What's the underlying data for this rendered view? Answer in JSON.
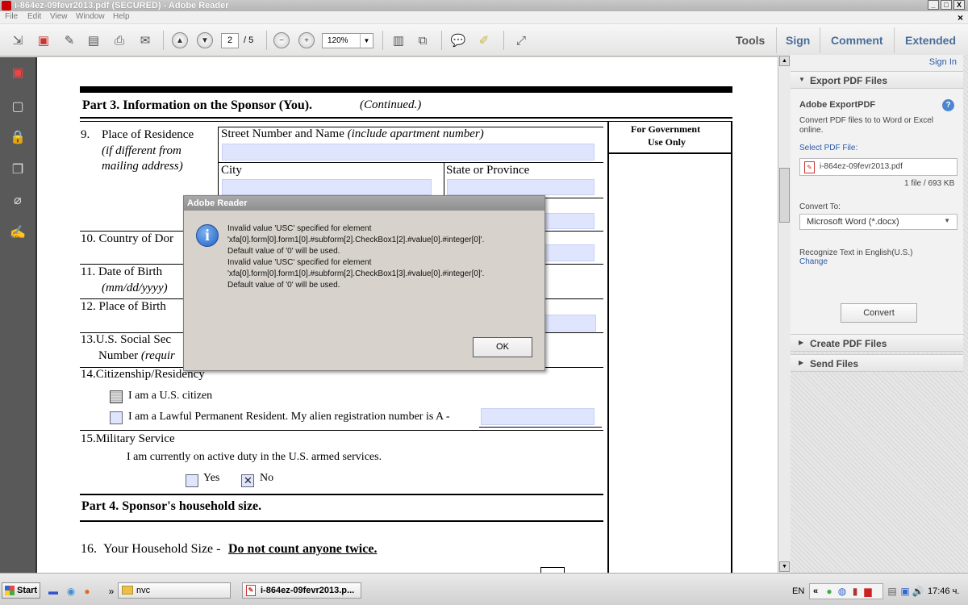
{
  "window": {
    "title": "i-864ez-09fevr2013.pdf (SECURED) - Adobe Reader",
    "buttons": [
      "_",
      "□",
      "X"
    ]
  },
  "menu": {
    "items": [
      "File",
      "Edit",
      "View",
      "Window",
      "Help"
    ],
    "close": "×"
  },
  "toolbar": {
    "page_current": "2",
    "page_total": "/ 5",
    "zoom": "120%",
    "tabs": [
      "Tools",
      "Sign",
      "Comment",
      "Extended"
    ]
  },
  "document": {
    "part3_heading": "Part 3. Information on the Sponsor (You).",
    "part3_continued": "(Continued.)",
    "gov_use_1": "For Government",
    "gov_use_2": "Use Only",
    "q9_num": "9.",
    "q9_label": "Place of Residence",
    "q9_sub1": "(if different from",
    "q9_sub2": "mailing address)",
    "street_label": "Street Number and Name",
    "street_hint": "(include apartment number)",
    "city_label": "City",
    "state_label": "State or Province",
    "q10": "10. Country of Dor",
    "q11": "11. Date of Birth",
    "q11_sub": "(mm/dd/yyyy)",
    "q12": "12. Place of Birth",
    "q13": "13.U.S. Social Sec",
    "q13_sub": "Number",
    "q13_hint": "(requir",
    "q14": "14.Citizenship/Residency",
    "q14_opt1": "I am a U.S. citizen",
    "q14_opt2": "I am a Lawful Permanent Resident.  My alien registration number is A -",
    "q15": "15.Military Service",
    "q15_text": "I am currently on active duty in the U.S. armed services.",
    "q15_yes": "Yes",
    "q15_no": "No",
    "part4_heading": "Part 4. Sponsor's household size.",
    "q16_num": "16.",
    "q16_label": "Your Household Size -",
    "q16_emph": "Do not count anyone twice."
  },
  "right_pane": {
    "sign_in": "Sign In",
    "export_header": "Export PDF Files",
    "export_title": "Adobe ExportPDF",
    "export_desc_1": "Convert PDF files to to Word or Excel",
    "export_desc_2": "online.",
    "select_file_label": "Select PDF File:",
    "file_name": "i-864ez-09fevr2013.pdf",
    "file_count": "1 file / 693 KB",
    "convert_to_label": "Convert To:",
    "convert_to_value": "Microsoft Word (*.docx)",
    "recognize_text": "Recognize Text in English(U.S.)",
    "change_link": "Change",
    "convert_button": "Convert",
    "create_header": "Create PDF Files",
    "send_header": "Send Files"
  },
  "dialog": {
    "title": "Adobe Reader",
    "lines": [
      "Invalid value 'USC' specified for element",
      "'xfa[0].form[0].form1[0].#subform[2].CheckBox1[2].#value[0].#integer[0]'.",
      "Default value of '0' will be used.",
      "Invalid value 'USC' specified for element",
      "'xfa[0].form[0].form1[0].#subform[2].CheckBox1[3].#value[0].#integer[0]'.",
      "Default value of '0' will be used."
    ],
    "ok_label": "OK"
  },
  "taskbar": {
    "start_label": "Start",
    "chevron": "»",
    "folder_label": "nvc",
    "task_label": "i-864ez-09fevr2013.p...",
    "lang": "EN",
    "tray_chevron": "«",
    "time": "17:46 ч."
  }
}
